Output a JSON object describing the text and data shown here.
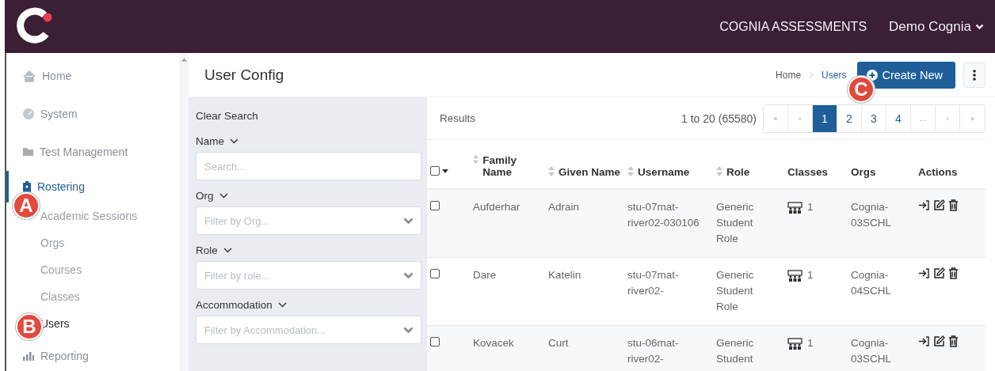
{
  "topbar": {
    "app_name": "COGNIA ASSESSMENTS",
    "user_menu": "Demo Cognia"
  },
  "sidebar": {
    "items": [
      {
        "label": "Home",
        "selected": false
      },
      {
        "label": "System",
        "selected": false
      },
      {
        "label": "Test Management",
        "selected": false
      },
      {
        "label": "Rostering",
        "selected": true,
        "children": [
          {
            "label": "Academic Sessions",
            "selected": false
          },
          {
            "label": "Orgs",
            "selected": false
          },
          {
            "label": "Courses",
            "selected": false
          },
          {
            "label": "Classes",
            "selected": false
          },
          {
            "label": "Users",
            "selected": true
          }
        ]
      },
      {
        "label": "Reporting",
        "selected": false
      }
    ]
  },
  "page_title": "User Config",
  "breadcrumb": [
    "Home",
    "Users"
  ],
  "create_button": "Create New",
  "filters": {
    "clear": "Clear Search",
    "fields": [
      {
        "label": "Name",
        "kind": "text",
        "placeholder": "Search..."
      },
      {
        "label": "Org",
        "kind": "select",
        "placeholder": "Filter by Org..."
      },
      {
        "label": "Role",
        "kind": "select",
        "placeholder": "Filter by role..."
      },
      {
        "label": "Accommodation",
        "kind": "select",
        "placeholder": "Filter by Accommodation..."
      }
    ]
  },
  "results": {
    "label": "Results",
    "range": "1 to 20 (65580)",
    "select_all": {
      "checked": false
    },
    "pagination": [
      {
        "label": "«",
        "selected": false
      },
      {
        "label": "‹",
        "selected": false
      },
      {
        "label": "1",
        "selected": true
      },
      {
        "label": "2",
        "selected": false
      },
      {
        "label": "3",
        "selected": false
      },
      {
        "label": "4",
        "selected": false
      },
      {
        "label": "…",
        "selected": false
      },
      {
        "label": "›",
        "selected": false
      },
      {
        "label": "»",
        "selected": false
      }
    ],
    "columns": [
      {
        "label": "Family Name",
        "sortable": true
      },
      {
        "label": "Given Name",
        "sortable": true
      },
      {
        "label": "Username",
        "sortable": true
      },
      {
        "label": "Role",
        "sortable": true
      },
      {
        "label": "Classes",
        "sortable": false
      },
      {
        "label": "Orgs",
        "sortable": false
      },
      {
        "label": "Actions",
        "sortable": false
      }
    ],
    "rows": [
      {
        "checked": false,
        "family_name": "Aufderhar",
        "given_name": "Adrain",
        "username": "stu-07mat-river02-030106",
        "role": "Generic Student Role",
        "classes": "1",
        "orgs": "Cognia-03SCHL"
      },
      {
        "checked": false,
        "family_name": "Dare",
        "given_name": "Katelin",
        "username": "stu-07mat-river02-",
        "role": "Generic Student Role",
        "classes": "1",
        "orgs": "Cognia-04SCHL"
      },
      {
        "checked": false,
        "family_name": "Kovacek",
        "given_name": "Curt",
        "username": "stu-06mat-river02-",
        "role": "Generic Student",
        "classes": "1",
        "orgs": "Cognia-03SCHL"
      }
    ]
  },
  "callouts": [
    "A",
    "B",
    "C"
  ]
}
